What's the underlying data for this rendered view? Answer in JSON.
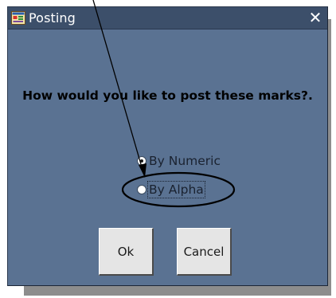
{
  "window": {
    "title": "Posting",
    "close_symbol": "✕"
  },
  "dialog": {
    "question": "How would you like to post these marks?.",
    "options": [
      {
        "label": "By Numeric",
        "selected": true
      },
      {
        "label": "By Alpha",
        "selected": false
      }
    ],
    "buttons": {
      "ok_label": "Ok",
      "cancel_label": "Cancel"
    }
  },
  "colors": {
    "dialog_background": "#5a7292",
    "titlebar_background": "#3c4f6a",
    "button_face": "#e5e5e5",
    "annotation_stroke": "#000000"
  },
  "icons": {
    "app": "forms-app-icon",
    "close": "close-icon"
  }
}
